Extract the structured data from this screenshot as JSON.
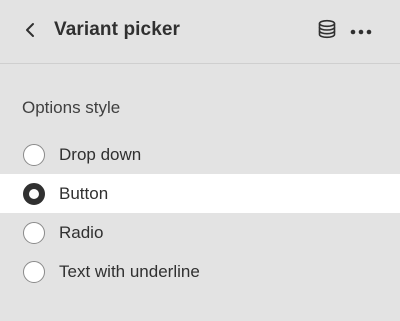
{
  "header": {
    "title": "Variant picker",
    "back_icon": "chevron-left-icon",
    "database_icon": "database-icon",
    "more_icon": "more-horizontal-icon"
  },
  "options_style": {
    "label": "Options style",
    "selected": "Button",
    "options": [
      {
        "label": "Drop down",
        "selected": false
      },
      {
        "label": "Button",
        "selected": true
      },
      {
        "label": "Radio",
        "selected": false
      },
      {
        "label": "Text with underline",
        "selected": false
      }
    ]
  },
  "colors": {
    "background": "#e3e3e3",
    "selected_row": "#ffffff",
    "text": "#303030"
  }
}
